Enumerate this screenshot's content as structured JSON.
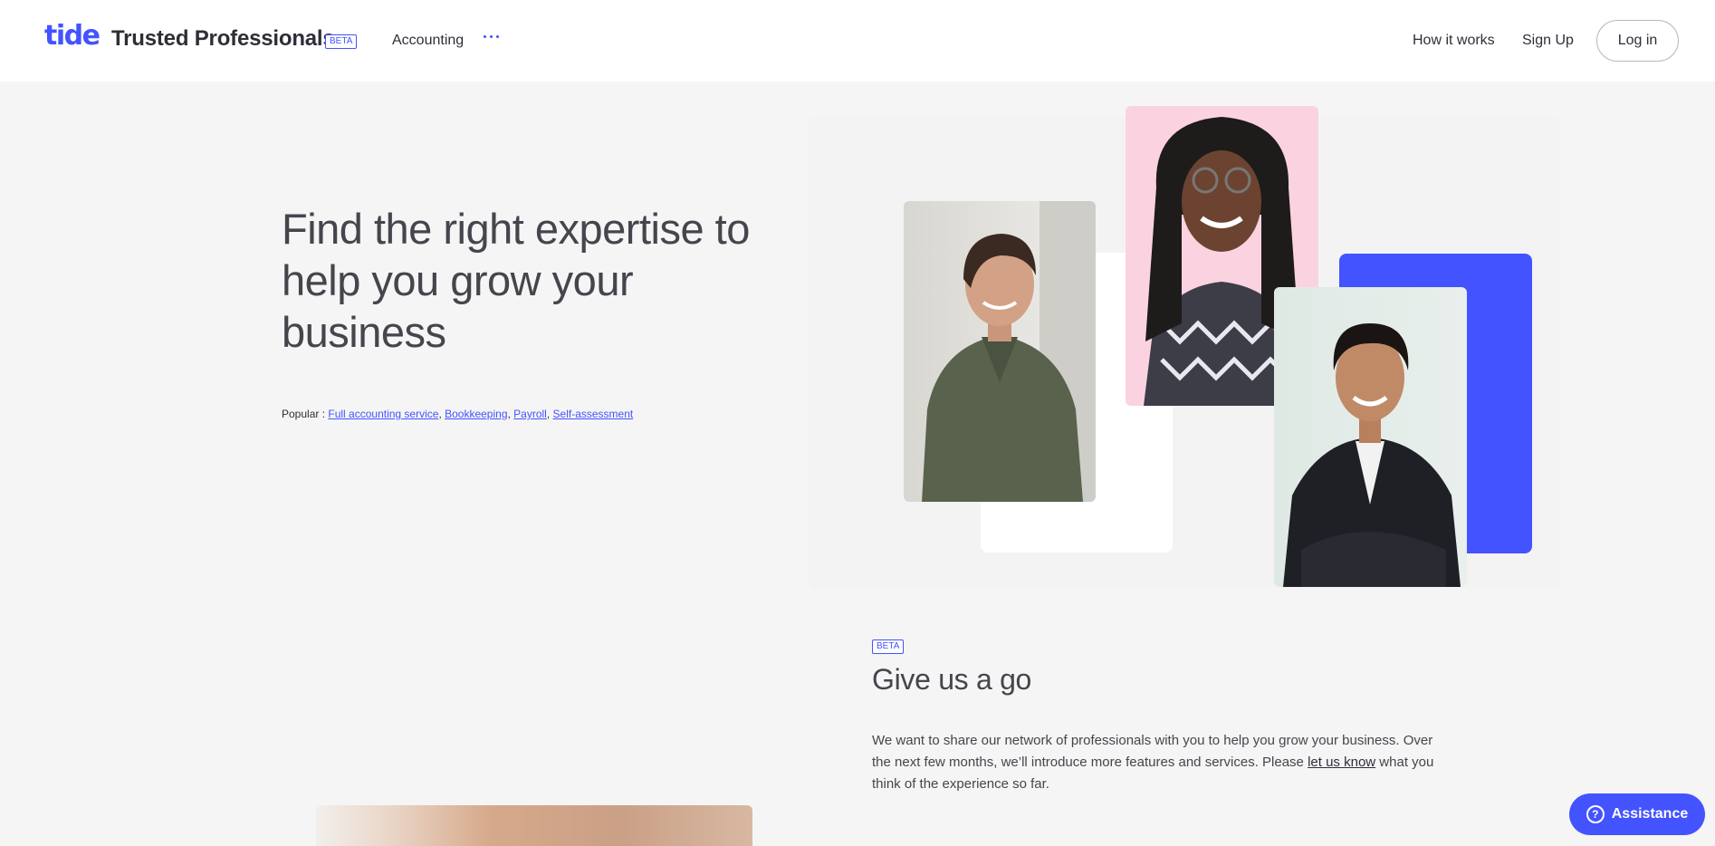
{
  "header": {
    "logo": "tide",
    "product_name": "Trusted Professionals",
    "beta_label": "BETA",
    "nav_accounting": "Accounting",
    "nav_how": "How it works",
    "nav_signup": "Sign Up",
    "login_label": "Log in"
  },
  "hero": {
    "title": "Find the right expertise to help you grow your business",
    "popular_label": "Popular :",
    "popular_links": [
      "Full accounting service",
      "Bookkeeping",
      "Payroll",
      "Self-assessment"
    ]
  },
  "section2": {
    "beta_label": "BETA",
    "title": "Give us a go",
    "text_before": "We want to share our network of professionals with you to help you grow your business. Over the next few months, we’ll introduce more features and services. Please",
    "link_label": "let us know",
    "text_after": "what you think of the experience so far."
  },
  "assistance": {
    "label": "Assistance",
    "icon": "help-icon"
  },
  "colors": {
    "brand": "#4353ff",
    "pink": "#fbd3e0",
    "background": "#f5f5f5"
  }
}
